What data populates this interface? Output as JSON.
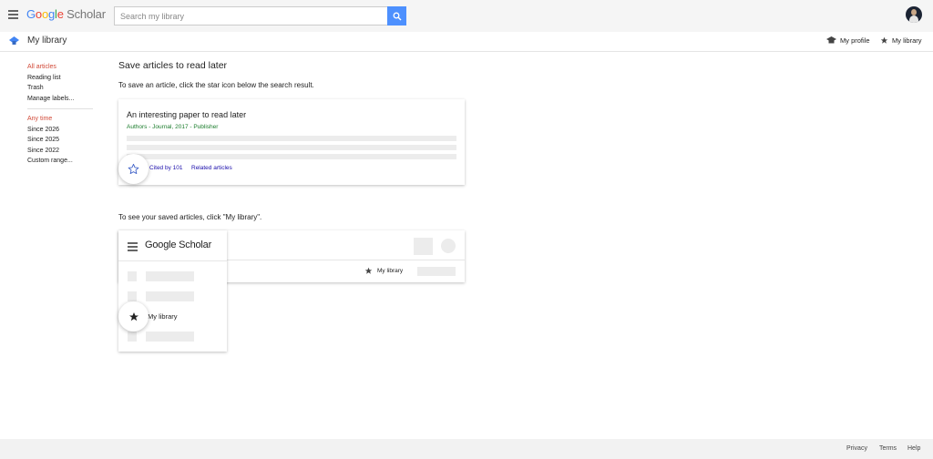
{
  "header": {
    "logo": {
      "part1": "G",
      "part2": "o",
      "part3": "o",
      "part4": "g",
      "part5": "l",
      "part6": "e",
      "part7": " Scholar"
    },
    "search": {
      "placeholder": "Search my library",
      "value": ""
    },
    "icons": {
      "menu": "menu-icon",
      "search": "search-icon",
      "avatar": "user-avatar"
    }
  },
  "subheader": {
    "title": "My library",
    "links": {
      "profile": "My profile",
      "library": "My library"
    }
  },
  "sidebar": {
    "filters": [
      {
        "label": "All articles",
        "active": true
      },
      {
        "label": "Reading list",
        "active": false
      },
      {
        "label": "Trash",
        "active": false
      },
      {
        "label": "Manage labels...",
        "active": false
      }
    ],
    "time_filters": [
      {
        "label": "Any time",
        "active": true
      },
      {
        "label": "Since 2026",
        "active": false
      },
      {
        "label": "Since 2025",
        "active": false
      },
      {
        "label": "Since 2022",
        "active": false
      },
      {
        "label": "Custom range...",
        "active": false
      }
    ]
  },
  "main": {
    "heading": "Save articles to read later",
    "instruction1": "To save an article, click the star icon below the search result.",
    "example": {
      "title": "An interesting paper to read later",
      "meta": "Authors - Journal, 2017 - Publisher",
      "cited_by": "Cited by 101",
      "related": "Related articles"
    },
    "instruction2": "To see your saved articles, click \"My library\".",
    "illustration": {
      "logo": {
        "part1": "G",
        "part2": "o",
        "part3": "o",
        "part4": "g",
        "part5": "l",
        "part6": "e",
        "part7": " Scholar"
      },
      "library_label": "My library",
      "header_library_label": "My library"
    }
  },
  "footer": {
    "privacy": "Privacy",
    "terms": "Terms",
    "help": "Help"
  },
  "colors": {
    "accent_blue": "#4d90fe",
    "active_red": "#d14836",
    "meta_green": "#1a7c2b",
    "link_blue": "#1a0dab"
  }
}
